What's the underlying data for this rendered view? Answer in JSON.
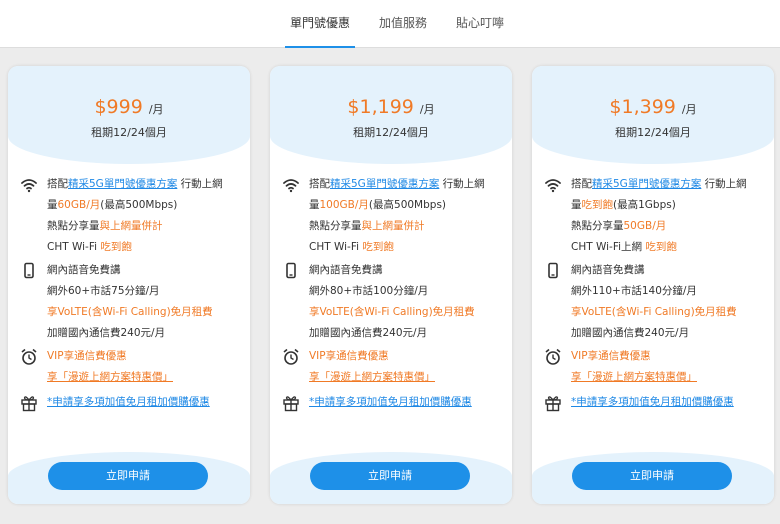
{
  "tabs": [
    {
      "label": "單門號優惠"
    },
    {
      "label": "加值服務"
    },
    {
      "label": "貼心叮嚀"
    }
  ],
  "plans": [
    {
      "price": "$999",
      "per": "/月",
      "term": "租期12/24個月",
      "net": {
        "pre": "搭配",
        "link": "精采5G單門號優惠方案",
        "post": "行動上網",
        "line2_pre": "量",
        "line2_hl": "60GB/月",
        "line2_post": "(最高500Mbps)",
        "line3_pre": "熱點分享量",
        "line3_hl": "與上網量併計",
        "line4_pre": "CHT Wi-Fi",
        "line4_hl": "吃到飽"
      },
      "voice": {
        "line1": "網內語音免費講",
        "line2": "網外60+市話75分鐘/月",
        "line3": "享VoLTE(含Wi-Fi Calling)免月租費",
        "line4": "加贈國內通信費240元/月"
      },
      "vip": {
        "line1": "VIP享通信費優惠",
        "line2": "享「漫遊上網方案特惠價」"
      },
      "gift": {
        "line1": "*申請享多項加值免月租加價購優惠"
      },
      "button": "立即申請"
    },
    {
      "price": "$1,199",
      "per": "/月",
      "term": "租期12/24個月",
      "net": {
        "pre": "搭配",
        "link": "精采5G單門號優惠方案",
        "post": "行動上網",
        "line2_pre": "量",
        "line2_hl": "100GB/月",
        "line2_post": "(最高500Mbps)",
        "line3_pre": "熱點分享量",
        "line3_hl": "與上網量併計",
        "line4_pre": "CHT Wi-Fi",
        "line4_hl": "吃到飽"
      },
      "voice": {
        "line1": "網內語音免費講",
        "line2": "網外80+市話100分鐘/月",
        "line3": "享VoLTE(含Wi-Fi Calling)免月租費",
        "line4": "加贈國內通信費240元/月"
      },
      "vip": {
        "line1": "VIP享通信費優惠",
        "line2": "享「漫遊上網方案特惠價」"
      },
      "gift": {
        "line1": "*申請享多項加值免月租加價購優惠"
      },
      "button": "立即申請"
    },
    {
      "price": "$1,399",
      "per": "/月",
      "term": "租期12/24個月",
      "net": {
        "pre": "搭配",
        "link": "精采5G單門號優惠方案",
        "post": "行動上網",
        "line2_pre": "量",
        "line2_hl": "吃到飽",
        "line2_post": "(最高1Gbps)",
        "line3_pre": "熱點分享量",
        "line3_hl": "50GB/月",
        "line4_pre": "CHT Wi-Fi上網",
        "line4_hl": "吃到飽"
      },
      "voice": {
        "line1": "網內語音免費講",
        "line2": "網外110+市話140分鐘/月",
        "line3": "享VoLTE(含Wi-Fi Calling)免月租費",
        "line4": "加贈國內通信費240元/月"
      },
      "vip": {
        "line1": "VIP享通信費優惠",
        "line2": "享「漫遊上網方案特惠價」"
      },
      "gift": {
        "line1": "*申請享多項加值免月租加價購優惠"
      },
      "button": "立即申請"
    }
  ],
  "colors": {
    "accent_blue": "#1e90e8",
    "highlight_orange": "#f07a26",
    "card_tint": "#e4f2fc"
  }
}
